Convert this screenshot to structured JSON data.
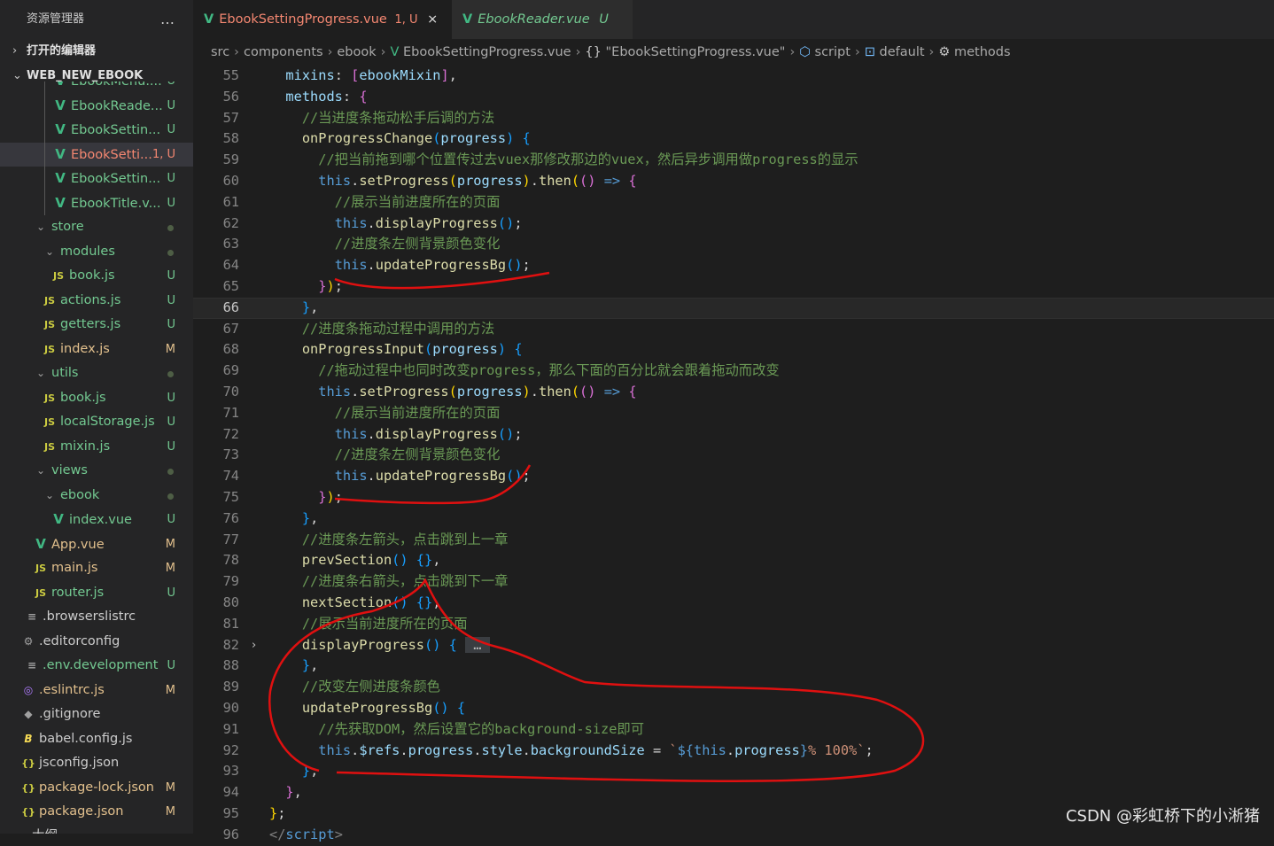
{
  "sidebar": {
    "title": "资源管理器",
    "more_icon": "…",
    "open_editors": "打开的编辑器",
    "project": "WEB_NEW_EBOOK",
    "items": [
      {
        "indent": 58,
        "icon": "vue",
        "label": "EbookMenu....",
        "badge": "U",
        "kind": "u",
        "guide": true
      },
      {
        "indent": 58,
        "icon": "vue",
        "label": "EbookReade...",
        "badge": "U",
        "kind": "u",
        "guide": true
      },
      {
        "indent": 58,
        "icon": "vue",
        "label": "EbookSettin...",
        "badge": "U",
        "kind": "u",
        "guide": true
      },
      {
        "indent": 58,
        "icon": "vue",
        "label": "EbookSetti...",
        "badge": "1, U",
        "kind": "e",
        "guide": true,
        "selected": true
      },
      {
        "indent": 58,
        "icon": "vue",
        "label": "EbookSettin...",
        "badge": "U",
        "kind": "u",
        "guide": true
      },
      {
        "indent": 58,
        "icon": "vue",
        "label": "EbookTitle.v...",
        "badge": "U",
        "kind": "u",
        "guide": true
      },
      {
        "indent": 36,
        "icon": "chevron",
        "label": "store",
        "badge": "",
        "kind": "dot"
      },
      {
        "indent": 46,
        "icon": "chevron",
        "label": "modules",
        "badge": "",
        "kind": "dot"
      },
      {
        "indent": 56,
        "icon": "js",
        "label": "book.js",
        "badge": "U",
        "kind": "u"
      },
      {
        "indent": 46,
        "icon": "js",
        "label": "actions.js",
        "badge": "U",
        "kind": "u"
      },
      {
        "indent": 46,
        "icon": "js",
        "label": "getters.js",
        "badge": "U",
        "kind": "u"
      },
      {
        "indent": 46,
        "icon": "js",
        "label": "index.js",
        "badge": "M",
        "kind": "m"
      },
      {
        "indent": 36,
        "icon": "chevron",
        "label": "utils",
        "badge": "",
        "kind": "dot"
      },
      {
        "indent": 46,
        "icon": "js",
        "label": "book.js",
        "badge": "U",
        "kind": "u"
      },
      {
        "indent": 46,
        "icon": "js",
        "label": "localStorage.js",
        "badge": "U",
        "kind": "u"
      },
      {
        "indent": 46,
        "icon": "js",
        "label": "mixin.js",
        "badge": "U",
        "kind": "u"
      },
      {
        "indent": 36,
        "icon": "chevron",
        "label": "views",
        "badge": "",
        "kind": "dot"
      },
      {
        "indent": 46,
        "icon": "chevron",
        "label": "ebook",
        "badge": "",
        "kind": "dot"
      },
      {
        "indent": 56,
        "icon": "vue",
        "label": "index.vue",
        "badge": "U",
        "kind": "u"
      },
      {
        "indent": 36,
        "icon": "vue",
        "label": "App.vue",
        "badge": "M",
        "kind": "m"
      },
      {
        "indent": 36,
        "icon": "js",
        "label": "main.js",
        "badge": "M",
        "kind": "m"
      },
      {
        "indent": 36,
        "icon": "js",
        "label": "router.js",
        "badge": "U",
        "kind": "u"
      },
      {
        "indent": 26,
        "icon": "lines",
        "label": ".browserslistrc",
        "badge": "",
        "kind": "none"
      },
      {
        "indent": 22,
        "icon": "gear",
        "label": ".editorconfig",
        "badge": "",
        "kind": "none"
      },
      {
        "indent": 26,
        "icon": "lines",
        "label": ".env.development",
        "badge": "U",
        "kind": "u"
      },
      {
        "indent": 22,
        "icon": "eslint",
        "label": ".eslintrc.js",
        "badge": "M",
        "kind": "m"
      },
      {
        "indent": 22,
        "icon": "git",
        "label": ".gitignore",
        "badge": "",
        "kind": "none"
      },
      {
        "indent": 22,
        "icon": "babel",
        "label": "babel.config.js",
        "badge": "",
        "kind": "none"
      },
      {
        "indent": 22,
        "icon": "json",
        "label": "jsconfig.json",
        "badge": "",
        "kind": "none"
      },
      {
        "indent": 22,
        "icon": "json",
        "label": "package-lock.json",
        "badge": "M",
        "kind": "m"
      },
      {
        "indent": 22,
        "icon": "json",
        "label": "package.json",
        "badge": "M",
        "kind": "m"
      },
      {
        "indent": 14,
        "icon": "chevron",
        "label": "大纲",
        "badge": "",
        "kind": "none"
      }
    ]
  },
  "tabs": [
    {
      "label": "EbookSettingProgress.vue",
      "status": "1, U",
      "close": "×",
      "active": true
    },
    {
      "label": "EbookReader.vue",
      "status": "U",
      "close": "",
      "active": false
    }
  ],
  "breadcrumb": [
    "src",
    "components",
    "ebook",
    "EbookSettingProgress.vue",
    "\"EbookSettingProgress.vue\"",
    "script",
    "default",
    "methods"
  ],
  "editor": {
    "current_line": "66",
    "lines": [
      {
        "n": "55",
        "html": "  <span class='v'>mixins</span>: <span class='b2'>[</span><span class='v'>ebookMixin</span><span class='b2'>]</span>,"
      },
      {
        "n": "56",
        "html": "  <span class='v'>methods</span>: <span class='b2'>{</span>"
      },
      {
        "n": "57",
        "html": "    <span class='c'>//当进度条拖动松手后调的方法</span>"
      },
      {
        "n": "58",
        "html": "    <span class='f'>onProgressChange</span><span class='b3'>(</span><span class='v'>progress</span><span class='b3'>)</span> <span class='b3'>{</span>"
      },
      {
        "n": "59",
        "html": "      <span class='c'>//把当前拖到哪个位置传过去vuex那修改那边的vuex，然后异步调用做progress的显示</span>"
      },
      {
        "n": "60",
        "html": "      <span class='k'>this</span>.<span class='f'>setProgress</span><span class='b1'>(</span><span class='v'>progress</span><span class='b1'>)</span>.<span class='f'>then</span><span class='b1'>(</span><span class='b2'>()</span> <span class='k'>=&gt;</span> <span class='b2'>{</span>"
      },
      {
        "n": "61",
        "html": "        <span class='c'>//展示当前进度所在的页面</span>"
      },
      {
        "n": "62",
        "html": "        <span class='k'>this</span>.<span class='f'>displayProgress</span><span class='b3'>()</span>;"
      },
      {
        "n": "63",
        "html": "        <span class='c'>//进度条左侧背景颜色变化</span>"
      },
      {
        "n": "64",
        "html": "        <span class='k'>this</span>.<span class='f'>updateProgressBg</span><span class='b3'>()</span>;"
      },
      {
        "n": "65",
        "html": "      <span class='b2'>}</span><span class='b1'>)</span>;"
      },
      {
        "n": "66",
        "html": "    <span class='b3'>}</span>,"
      },
      {
        "n": "67",
        "html": "    <span class='c'>//进度条拖动过程中调用的方法</span>"
      },
      {
        "n": "68",
        "html": "    <span class='f'>onProgressInput</span><span class='b3'>(</span><span class='v'>progress</span><span class='b3'>)</span> <span class='b3'>{</span>"
      },
      {
        "n": "69",
        "html": "      <span class='c'>//拖动过程中也同时改变progress，那么下面的百分比就会跟着拖动而改变</span>"
      },
      {
        "n": "70",
        "html": "      <span class='k'>this</span>.<span class='f'>setProgress</span><span class='b1'>(</span><span class='v'>progress</span><span class='b1'>)</span>.<span class='f'>then</span><span class='b1'>(</span><span class='b2'>()</span> <span class='k'>=&gt;</span> <span class='b2'>{</span>"
      },
      {
        "n": "71",
        "html": "        <span class='c'>//展示当前进度所在的页面</span>"
      },
      {
        "n": "72",
        "html": "        <span class='k'>this</span>.<span class='f'>displayProgress</span><span class='b3'>()</span>;"
      },
      {
        "n": "73",
        "html": "        <span class='c'>//进度条左侧背景颜色变化</span>"
      },
      {
        "n": "74",
        "html": "        <span class='k'>this</span>.<span class='f'>updateProgressBg</span><span class='b3'>()</span>;"
      },
      {
        "n": "75",
        "html": "      <span class='b2'>}</span><span class='b1'>)</span>;"
      },
      {
        "n": "76",
        "html": "    <span class='b3'>}</span>,"
      },
      {
        "n": "77",
        "html": "    <span class='c'>//进度条左箭头，点击跳到上一章</span>"
      },
      {
        "n": "78",
        "html": "    <span class='f'>prevSection</span><span class='b3'>()</span> <span class='b3'>{}</span>,"
      },
      {
        "n": "79",
        "html": "    <span class='c'>//进度条右箭头，点击跳到下一章</span>"
      },
      {
        "n": "80",
        "html": "    <span class='f'>nextSection</span><span class='b3'>()</span> <span class='b3'>{}</span>,"
      },
      {
        "n": "81",
        "html": "    <span class='c'>//展示当前进度所在的页面</span>"
      },
      {
        "n": "82",
        "html": "    <span class='f'>displayProgress</span><span class='b3'>()</span> <span class='b3'>{</span> <span style='background:#3a3d41;color:#bbb'> … </span>",
        "fold": true
      },
      {
        "n": "88",
        "html": "    <span class='b3'>}</span>,"
      },
      {
        "n": "89",
        "html": "    <span class='c'>//改变左侧进度条颜色</span>"
      },
      {
        "n": "90",
        "html": "    <span class='f'>updateProgressBg</span><span class='b3'>()</span> <span class='b3'>{</span>"
      },
      {
        "n": "91",
        "html": "      <span class='c'>//先获取DOM，然后设置它的background-size即可</span>"
      },
      {
        "n": "92",
        "html": "      <span class='k'>this</span>.<span class='v'>$refs</span>.<span class='v'>progress</span>.<span class='v'>style</span>.<span class='v'>backgroundSize</span> = <span class='s'>`</span><span class='k'>${</span><span class='k'>this</span>.<span class='v'>progress</span><span class='k'>}</span><span class='s'>% 100%`</span>;"
      },
      {
        "n": "93",
        "html": "    <span class='b3'>}</span>,"
      },
      {
        "n": "94",
        "html": "  <span class='b2'>}</span>,"
      },
      {
        "n": "95",
        "html": "<span class='b1'>}</span>;"
      },
      {
        "n": "96",
        "html": "<span style='color:#808080'>&lt;/</span><span class='k'>script</span><span style='color:#808080'>&gt;</span>"
      }
    ]
  },
  "watermark": "CSDN @彩虹桥下的小淅猪",
  "colors": {
    "annotation": "#e01010",
    "vue": "#41b883",
    "modified": "#e2c08d",
    "untracked": "#73c991"
  }
}
